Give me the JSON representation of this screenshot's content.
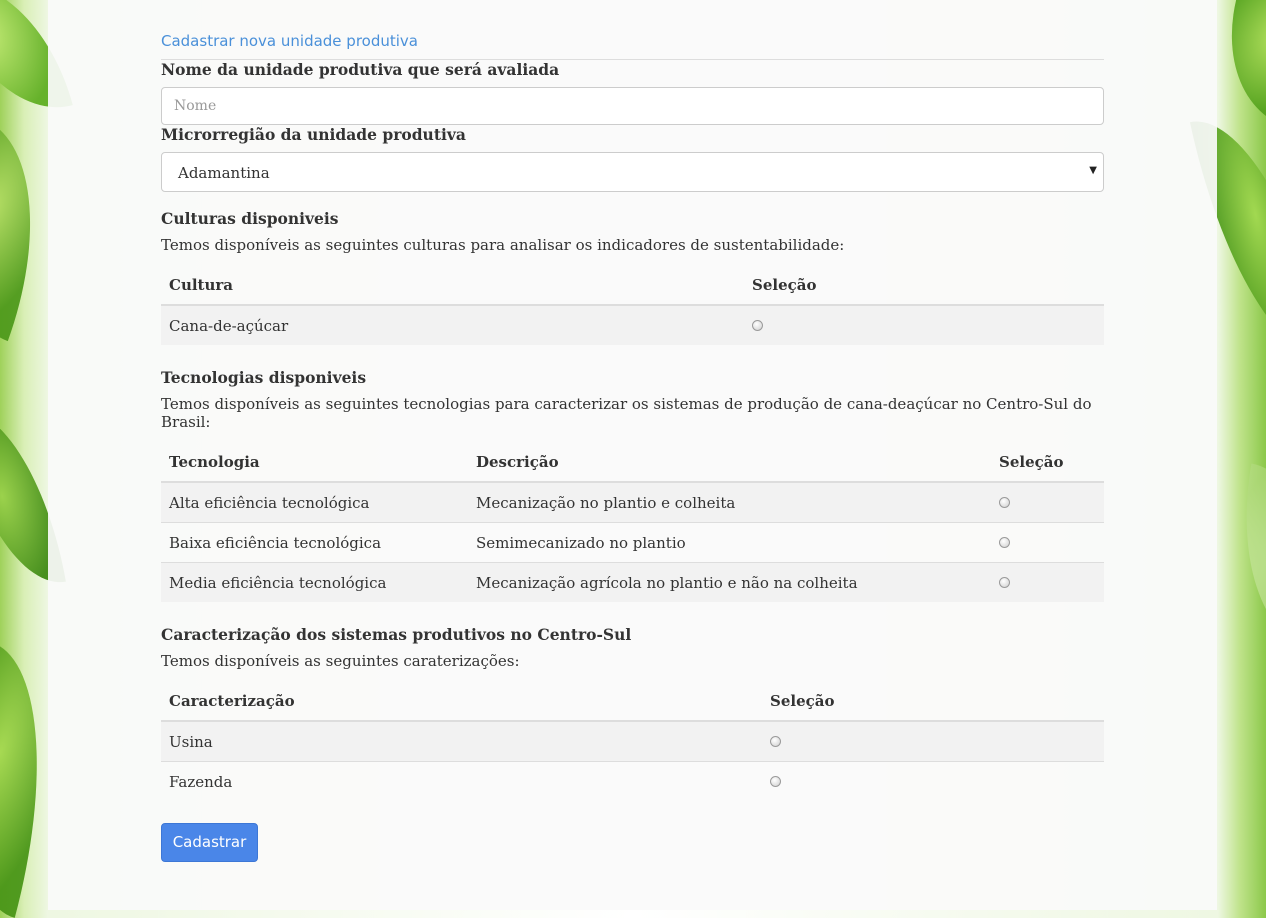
{
  "page_title": "Cadastrar nova unidade produtiva",
  "name_field": {
    "label": "Nome da unidade produtiva que será avaliada",
    "placeholder": "Nome",
    "value": ""
  },
  "microregion_field": {
    "label": "Microrregião da unidade produtiva",
    "selected": "Adamantina"
  },
  "cultures": {
    "title": "Culturas disponiveis",
    "description": "Temos disponíveis as seguintes culturas para analisar os indicadores de sustentabilidade:",
    "headers": {
      "culture": "Cultura",
      "selection": "Seleção"
    },
    "rows": [
      {
        "culture": "Cana-de-açúcar",
        "selected": false
      }
    ]
  },
  "technologies": {
    "title": "Tecnologias disponiveis",
    "description": "Temos disponíveis as seguintes tecnologias para caracterizar os sistemas de produção de cana-deaçúcar no Centro-Sul do Brasil:",
    "headers": {
      "technology": "Tecnologia",
      "description": "Descrição",
      "selection": "Seleção"
    },
    "rows": [
      {
        "technology": "Alta eficiência tecnológica",
        "description": "Mecanização no plantio e colheita",
        "selected": false
      },
      {
        "technology": "Baixa eficiência tecnológica",
        "description": "Semimecanizado no plantio",
        "selected": false
      },
      {
        "technology": "Media eficiência tecnológica",
        "description": "Mecanização agrícola no plantio e não na colheita",
        "selected": false
      }
    ]
  },
  "characterization": {
    "title": "Caracterização dos sistemas produtivos no Centro-Sul",
    "description": "Temos disponíveis as seguintes caraterizações:",
    "headers": {
      "characterization": "Caracterização",
      "selection": "Seleção"
    },
    "rows": [
      {
        "characterization": "Usina",
        "selected": false
      },
      {
        "characterization": "Fazenda",
        "selected": false
      }
    ]
  },
  "submit_label": "Cadastrar",
  "colors": {
    "accent": "#4a86e8",
    "title_link": "#4a90d9"
  }
}
